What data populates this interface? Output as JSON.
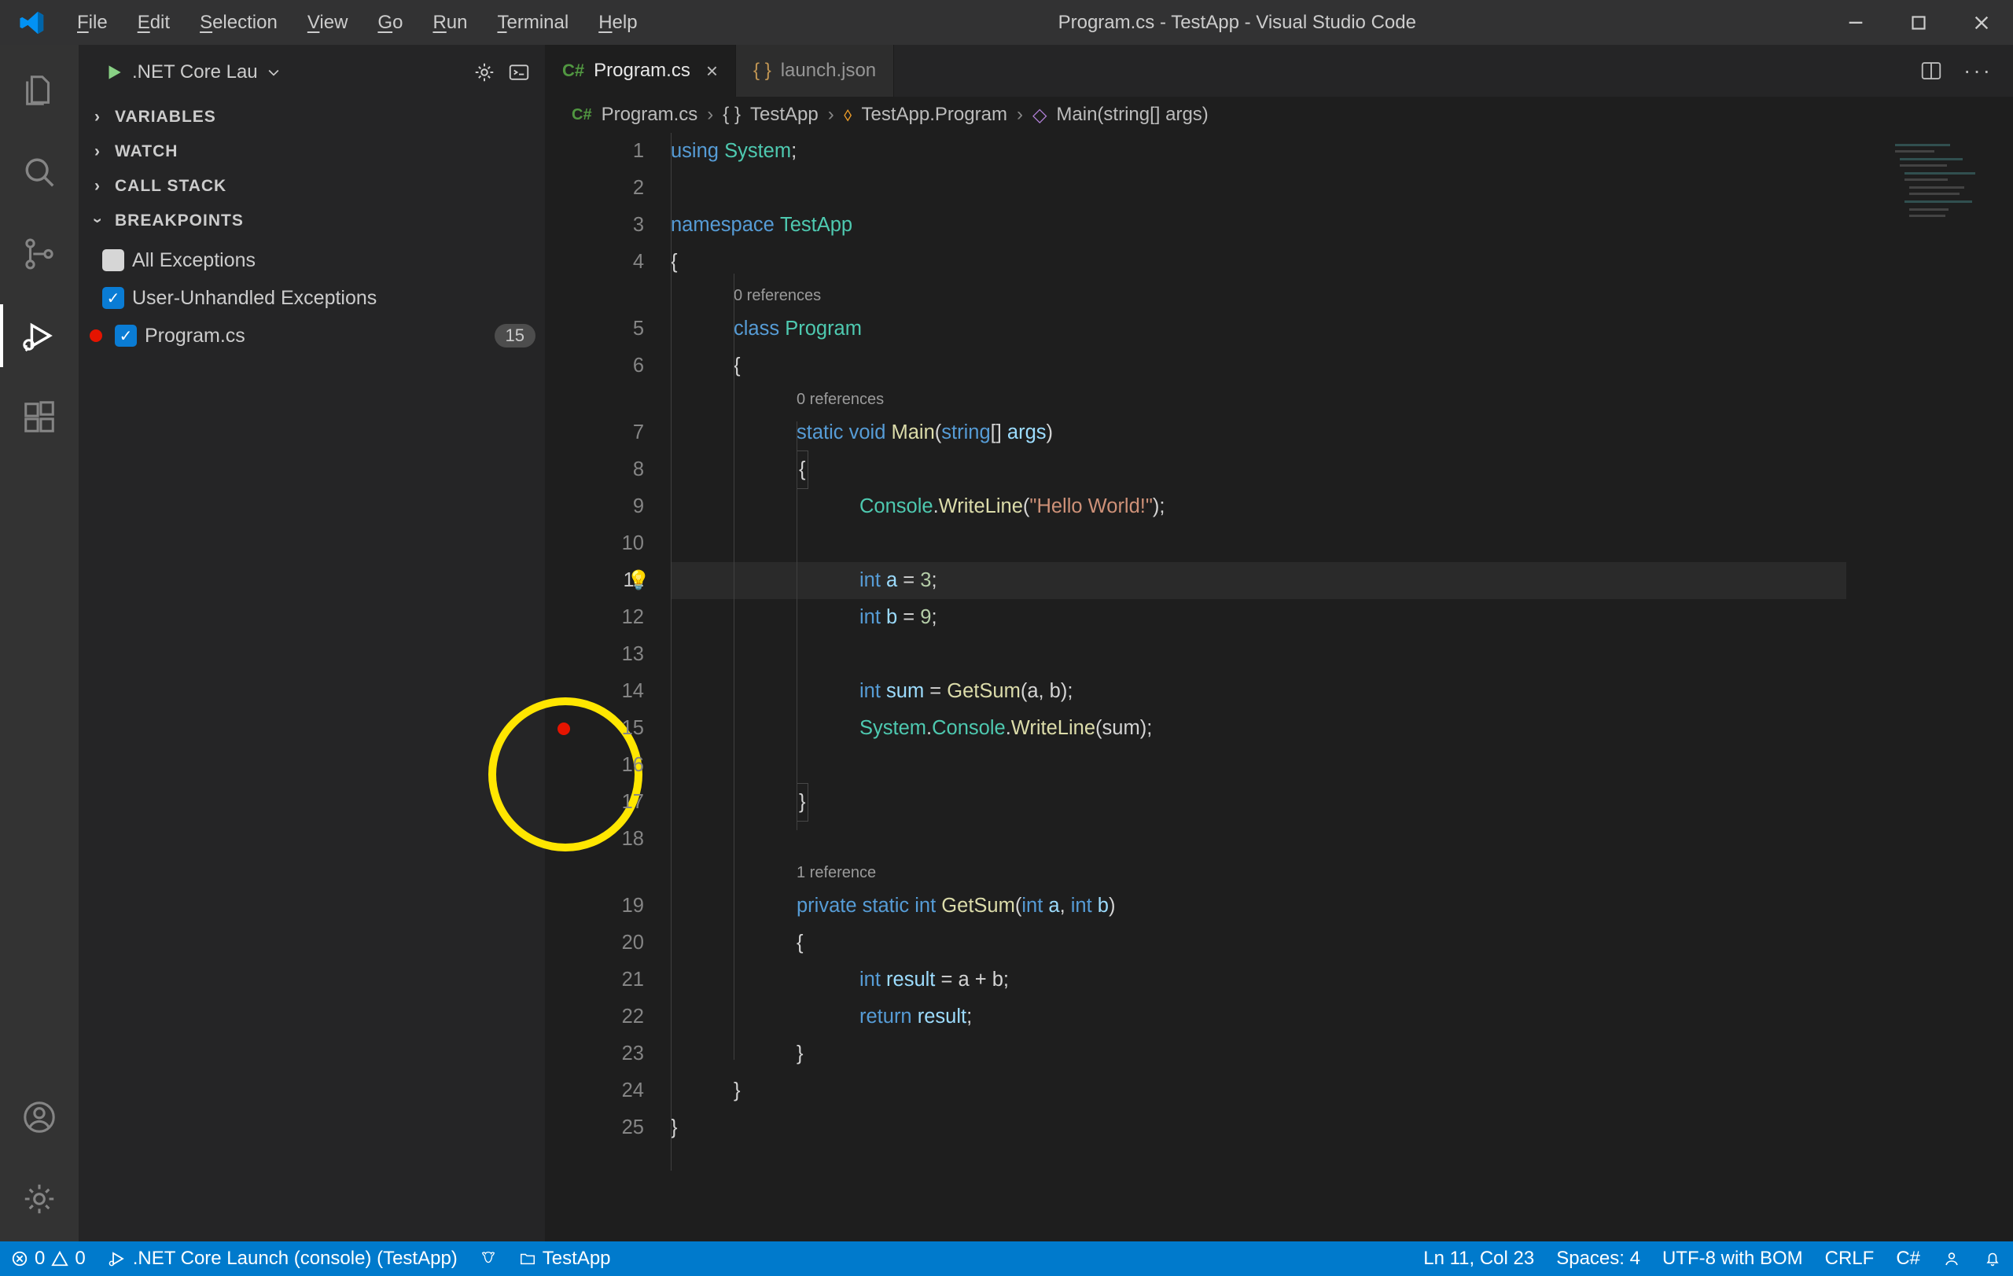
{
  "menubar": {
    "items": [
      "File",
      "Edit",
      "Selection",
      "View",
      "Go",
      "Run",
      "Terminal",
      "Help"
    ]
  },
  "window_title": "Program.cs - TestApp - Visual Studio Code",
  "debug": {
    "launch_selected": ".NET Core Lau",
    "panes": {
      "variables": "VARIABLES",
      "watch": "WATCH",
      "callstack": "CALL STACK",
      "breakpoints": "BREAKPOINTS"
    },
    "bp": {
      "all_exceptions": "All Exceptions",
      "user_unhandled": "User-Unhandled Exceptions",
      "file": "Program.cs",
      "file_badge": "15"
    }
  },
  "tabs": {
    "active": "Program.cs",
    "inactive": "launch.json"
  },
  "breadcrumb": {
    "a": "Program.cs",
    "b": "TestApp",
    "c": "TestApp.Program",
    "d": "Main(string[] args)"
  },
  "code": {
    "ref0": "0 references",
    "ref1": "1 reference",
    "l1": {
      "a": "using",
      "b": "System",
      "c": ";"
    },
    "l3": {
      "a": "namespace",
      "b": "TestApp"
    },
    "l4": "{",
    "l5": {
      "a": "class",
      "b": "Program"
    },
    "l6": "{",
    "l7": {
      "a": "static",
      "b": "void",
      "c": "Main",
      "d": "(",
      "e": "string",
      "f": "[] ",
      "g": "args",
      "h": ")"
    },
    "l8": "{",
    "l9": {
      "a": "Console",
      "b": ".",
      "c": "WriteLine",
      "d": "(",
      "e": "\"Hello World!\"",
      "f": ");"
    },
    "l11": {
      "a": "int",
      "b": "a",
      "c": " = ",
      "d": "3",
      "e": ";"
    },
    "l12": {
      "a": "int",
      "b": "b",
      "c": " = ",
      "d": "9",
      "e": ";"
    },
    "l14": {
      "a": "int",
      "b": "sum",
      "c": " = ",
      "d": "GetSum",
      "e": "(a, b);"
    },
    "l15": {
      "a": "System",
      "b": ".",
      "c": "Console",
      "d": ".",
      "e": "WriteLine",
      "f": "(sum);"
    },
    "l17": "}",
    "l19": {
      "a": "private",
      "b": "static",
      "c": "int",
      "d": "GetSum",
      "e": "(",
      "f": "int",
      "g": "a",
      "h": ", ",
      "i": "int",
      "j": "b",
      "k": ")"
    },
    "l20": "{",
    "l21": {
      "a": "int",
      "b": "result",
      "c": " = a + b;"
    },
    "l22": {
      "a": "return",
      "b": "result",
      "c": ";"
    },
    "l23": "}",
    "l24": "}",
    "l25": "}"
  },
  "status": {
    "errors": "0",
    "warnings": "0",
    "launch": ".NET Core Launch (console) (TestApp)",
    "folder": "TestApp",
    "pos": "Ln 11, Col 23",
    "spaces": "Spaces: 4",
    "enc": "UTF-8 with BOM",
    "eol": "CRLF",
    "lang": "C#"
  }
}
